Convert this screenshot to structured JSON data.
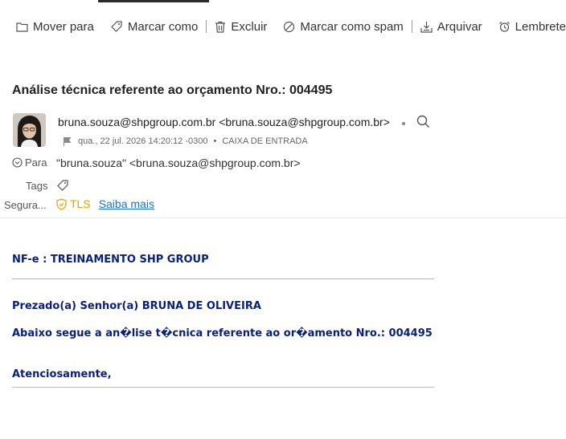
{
  "toolbar": {
    "move": "Mover para",
    "mark_as": "Marcar como",
    "delete": "Excluir",
    "mark_spam": "Marcar como spam",
    "archive": "Arquivar",
    "reminder": "Lembrete"
  },
  "email": {
    "subject": "Análise técnica referente ao orçamento Nro.: 004495",
    "sender": "bruna.souza@shpgroup.com.br <bruna.souza@shpgroup.com.br>",
    "date": "qua., 22 jul. 2026 14:20:12 -0300",
    "folder": "CAIXA DE ENTRADA",
    "to_label": "Para",
    "to_value": "\"bruna.souza\" <bruna.souza@shpgroup.com.br>",
    "tags_label": "Tags",
    "security_label": "Segura...",
    "tls": "TLS",
    "learn_more": "Saiba mais"
  },
  "body": {
    "line1": "NF-e : TREINAMENTO SHP GROUP",
    "greeting": "Prezado(a) Senhor(a) BRUNA DE OLIVEIRA",
    "message": "Abaixo segue a an�lise t�cnica referente ao or�amento Nro.: 004495",
    "closing": "Atenciosamente,"
  },
  "colors": {
    "body_text": "#0a1f7a",
    "tls": "#e8a100",
    "link": "#1a73c8"
  }
}
